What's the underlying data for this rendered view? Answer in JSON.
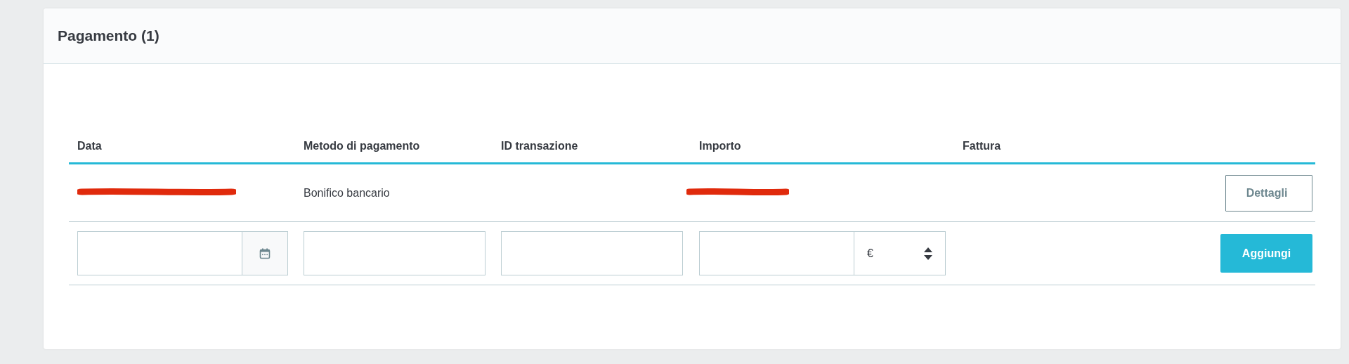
{
  "panel": {
    "title": "Pagamento (1)"
  },
  "table": {
    "columns": [
      "Data",
      "Metodo di pagamento",
      "ID transazione",
      "Importo",
      "Fattura"
    ],
    "rows": [
      {
        "date_redacted": true,
        "method": "Bonifico bancario",
        "amount_redacted": true,
        "action": "Dettagli"
      }
    ]
  },
  "form": {
    "currency": "€",
    "submit": "Aggiungi"
  }
}
